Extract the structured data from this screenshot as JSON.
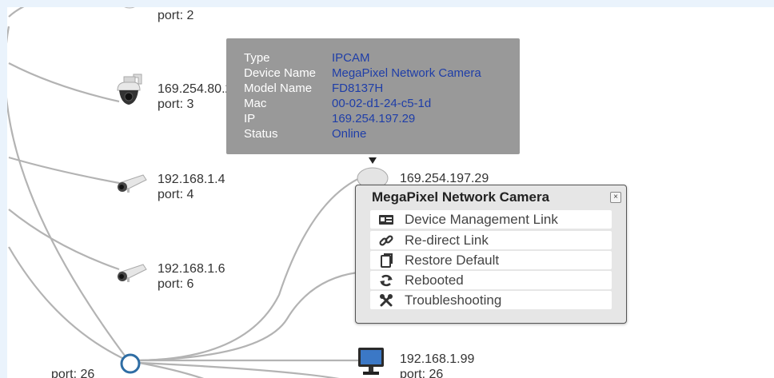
{
  "nodes": [
    {
      "id": "top",
      "ip": "",
      "port": "port: 2"
    },
    {
      "id": "ptz",
      "ip": "169.254.80.2...",
      "port": "port: 3"
    },
    {
      "id": "cam4",
      "ip": "192.168.1.4",
      "port": "port: 4"
    },
    {
      "id": "cam6",
      "ip": "192.168.1.6",
      "port": "port: 6"
    },
    {
      "id": "selected",
      "ip": "169.254.197.29",
      "port": ""
    },
    {
      "id": "monitor",
      "ip": "192.168.1.99",
      "port": "port: 26"
    },
    {
      "id": "hub",
      "ip": "",
      "port": "port: 26"
    }
  ],
  "tooltip": {
    "rows": [
      {
        "key": "Type",
        "value": "IPCAM"
      },
      {
        "key": "Device Name",
        "value": "MegaPixel Network Camera"
      },
      {
        "key": "Model Name",
        "value": "FD8137H"
      },
      {
        "key": "Mac",
        "value": "00-02-d1-24-c5-1d"
      },
      {
        "key": "IP",
        "value": "169.254.197.29"
      },
      {
        "key": "Status",
        "value": "Online"
      }
    ]
  },
  "popup": {
    "title": "MegaPixel Network Camera",
    "close": "×",
    "items": [
      {
        "label": "Device Management Link",
        "icon": "device-management-icon"
      },
      {
        "label": "Re-direct Link",
        "icon": "link-icon"
      },
      {
        "label": "Restore Default",
        "icon": "restore-default-icon"
      },
      {
        "label": "Rebooted",
        "icon": "reboot-icon"
      },
      {
        "label": "Troubleshooting",
        "icon": "tools-icon"
      }
    ]
  },
  "colors": {
    "background": "#eaf3fc",
    "link": "#b3b3b3",
    "tooltip_bg": "#999999",
    "tooltip_value": "#1f3ea8",
    "hub_ring": "#2e6da4"
  }
}
